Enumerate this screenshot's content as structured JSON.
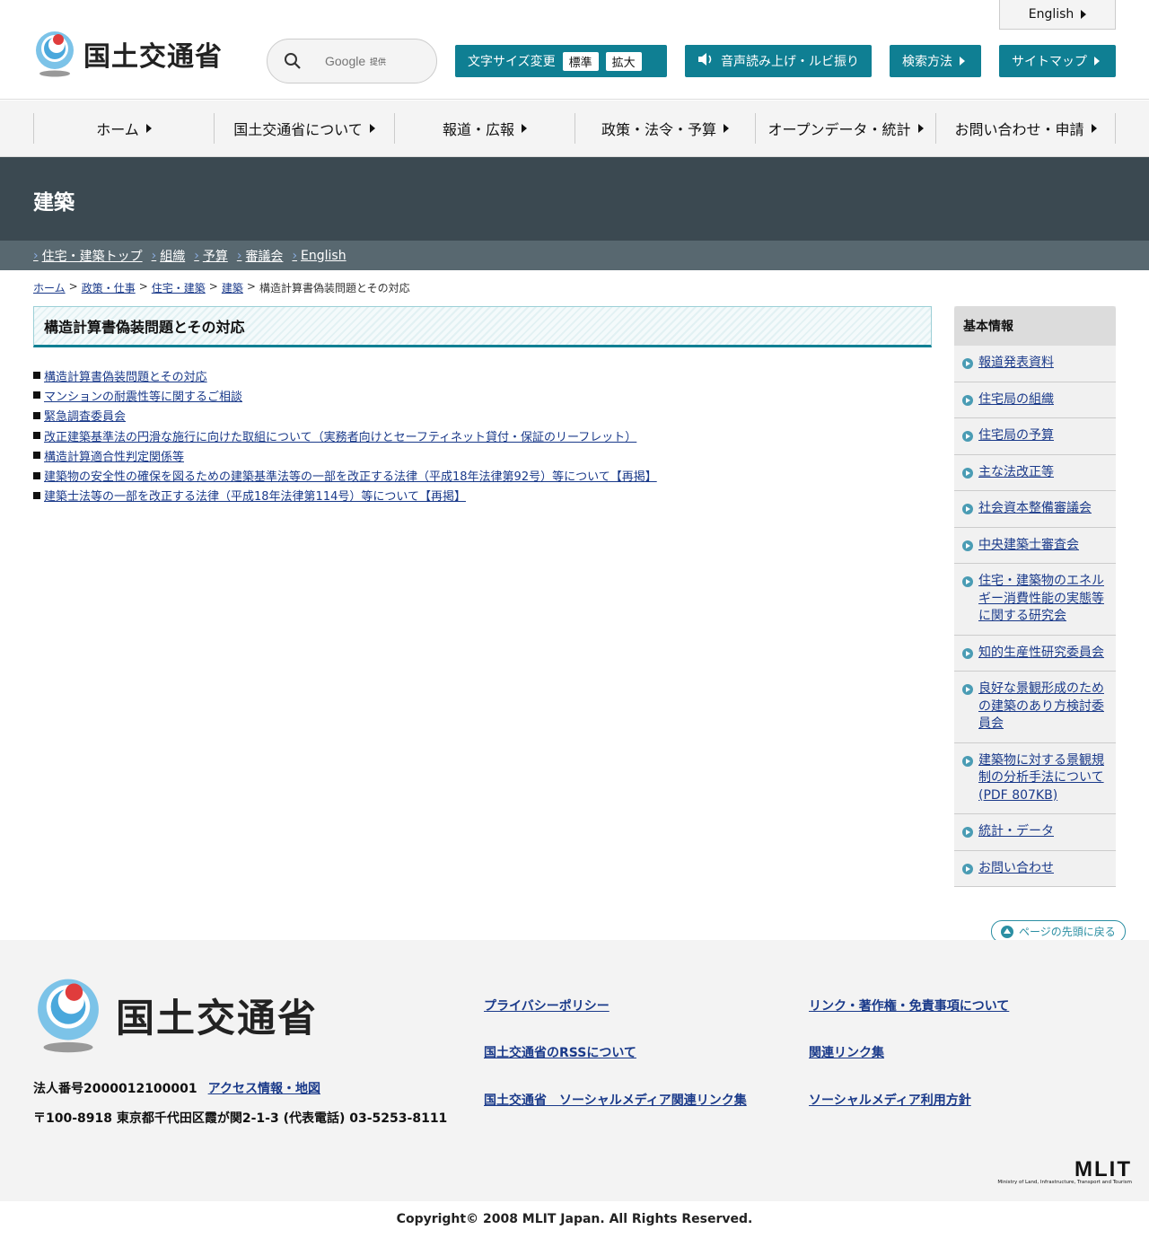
{
  "header": {
    "logo_text": "国土交通省",
    "search": {
      "placeholder": "Google",
      "provider": "提供"
    },
    "english_tab": "English",
    "font_size": {
      "label": "文字サイズ変更",
      "options": [
        "標準",
        "拡大"
      ]
    },
    "speech": "音声読み上げ・ルビ振り",
    "howto": "検索方法",
    "sitemap": "サイトマップ"
  },
  "gnav": [
    "ホーム",
    "国土交通省について",
    "報道・広報",
    "政策・法令・予算",
    "オープンデータ・統計",
    "お問い合わせ・申請"
  ],
  "section_title": "建築",
  "subnav": [
    "住宅・建築トップ",
    "組織",
    "予算",
    "審議会",
    "English"
  ],
  "breadcrumb": {
    "items": [
      "ホーム",
      "政策・仕事",
      "住宅・建築",
      "建築"
    ],
    "sep": ">",
    "current": "構造計算書偽装問題とその対応"
  },
  "page_title": "構造計算書偽装問題とその対応",
  "links": [
    "構造計算書偽装問題とその対応",
    "マンションの耐震性等に関するご相談",
    "緊急調査委員会",
    "改正建築基準法の円滑な施行に向けた取組について（実務者向けとセーフティネット貸付・保証のリーフレット）",
    "構造計算適合性判定関係等",
    "建築物の安全性の確保を図るための建築基準法等の一部を改正する法律（平成18年法律第92号）等について【再掲】",
    "建築士法等の一部を改正する法律（平成18年法律第114号）等について【再掲】"
  ],
  "sidebar": {
    "title": "基本情報",
    "items": [
      "報道発表資料",
      "住宅局の組織",
      "住宅局の予算",
      "主な法改正等",
      "社会資本整備審議会",
      "中央建築士審査会",
      "住宅・建築物のエネルギー消費性能の実態等に関する研究会",
      "知的生産性研究委員会",
      "良好な景観形成のための建築のあり方検討委員会",
      "建築物に対する景観規制の分析手法について(PDF 807KB)",
      "統計・データ",
      "お問い合わせ"
    ]
  },
  "to_top": "ページの先頭に戻る",
  "footer": {
    "logo_text": "国土交通省",
    "corp_no": "法人番号2000012100001",
    "access": "アクセス情報・地図",
    "address": "〒100-8918 東京都千代田区霞が関2-1-3 (代表電話) 03-5253-8111",
    "links": [
      "プライバシーポリシー",
      "リンク・著作権・免責事項について",
      "国土交通省のRSSについて",
      "関連リンク集",
      "国土交通省　ソーシャルメディア関連リンク集",
      "ソーシャルメディア利用方針"
    ],
    "mlit": "MLIT",
    "mlit_full": "Ministry of Land, Infrastructure, Transport and Tourism",
    "copyright": "Copyright© 2008 MLIT Japan. All Rights Reserved."
  },
  "colors": {
    "accent": "#0f7f93",
    "title_band": "#3b4951",
    "subnav": "#586870"
  }
}
